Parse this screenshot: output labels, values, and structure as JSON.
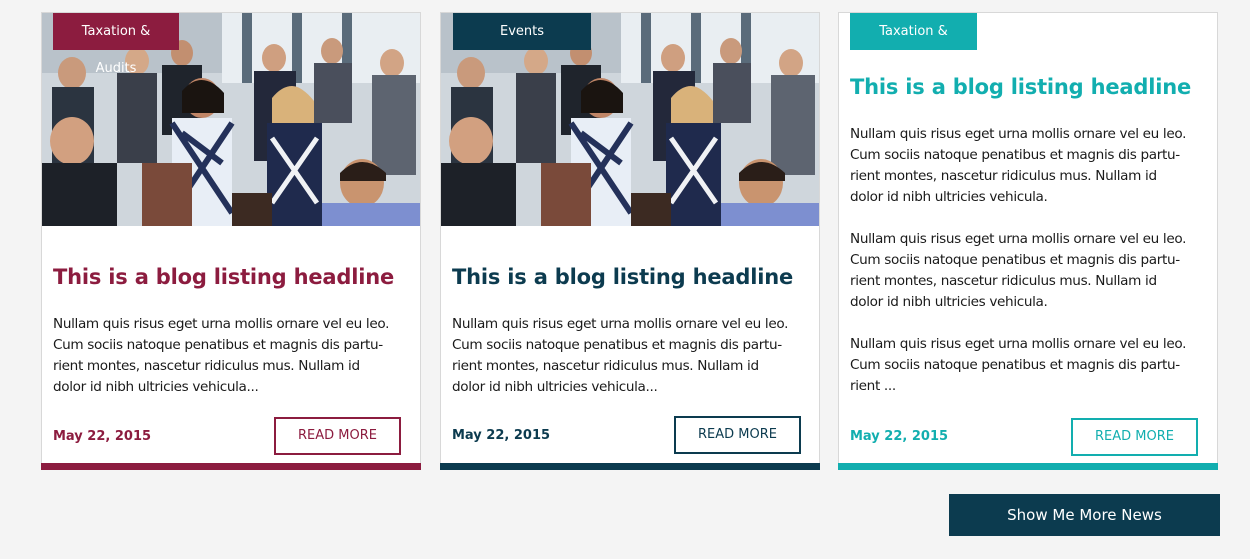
{
  "colors": {
    "burgundy": "#8c1c3f",
    "navy": "#0c3b4f",
    "teal": "#12aeaf",
    "page_background": "#f4f4f4"
  },
  "cards": [
    {
      "tag": "Taxation & Audits",
      "headline": "This is a blog listing headline",
      "image": "conference-networking-photo",
      "paragraphs": [
        [
          "Nullam quis risus eget urna mollis ornare vel eu leo.",
          "Cum sociis natoque penatibus et magnis dis partu-",
          "rient montes, nascetur ridiculus mus. Nullam id",
          "dolor id nibh ultricies vehicula..."
        ]
      ],
      "date": "May 22, 2015",
      "button": "READ MORE"
    },
    {
      "tag": "Events",
      "headline": "This is a blog listing headline",
      "image": "conference-networking-photo",
      "paragraphs": [
        [
          "Nullam quis risus eget urna mollis ornare vel eu leo.",
          "Cum sociis natoque penatibus et magnis dis partu-",
          "rient montes, nascetur ridiculus mus. Nullam id",
          "dolor id nibh ultricies vehicula..."
        ]
      ],
      "date": "May 22, 2015",
      "button": "READ MORE"
    },
    {
      "tag": "Taxation & Audits",
      "headline": "This is a blog listing headline",
      "paragraphs": [
        [
          "Nullam quis risus eget urna mollis ornare vel eu leo.",
          "Cum sociis natoque penatibus et magnis dis partu-",
          "rient montes, nascetur ridiculus mus. Nullam id",
          "dolor id nibh ultricies vehicula."
        ],
        [
          "Nullam quis risus eget urna mollis ornare vel eu leo.",
          "Cum sociis natoque penatibus et magnis dis partu-",
          "rient montes, nascetur ridiculus mus. Nullam id",
          "dolor id nibh ultricies vehicula."
        ],
        [
          "Nullam quis risus eget urna mollis ornare vel eu leo.",
          "Cum sociis natoque penatibus et magnis dis partu-",
          "rient ..."
        ]
      ],
      "date": "May 22, 2015",
      "button": "READ MORE"
    }
  ],
  "show_more_button": "Show Me More News"
}
